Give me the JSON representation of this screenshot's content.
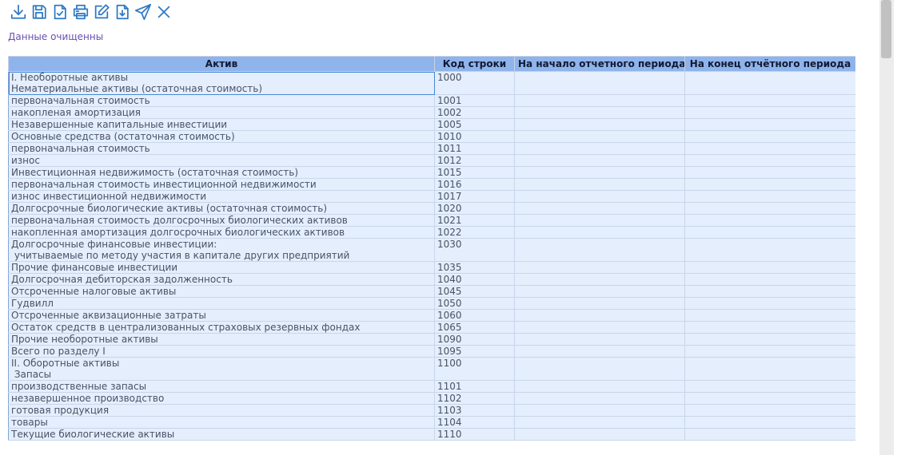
{
  "toolbar": {
    "buttons": [
      {
        "name": "download",
        "icon": "download-icon"
      },
      {
        "name": "save",
        "icon": "floppy-disk-icon"
      },
      {
        "name": "check-document",
        "icon": "document-check-icon"
      },
      {
        "name": "print",
        "icon": "printer-icon"
      },
      {
        "name": "edit",
        "icon": "pencil-square-icon"
      },
      {
        "name": "import",
        "icon": "document-download-icon"
      },
      {
        "name": "send",
        "icon": "paper-plane-icon"
      },
      {
        "name": "close",
        "icon": "close-icon"
      }
    ]
  },
  "status": {
    "text": "Данные  очищенны"
  },
  "table": {
    "headers": [
      "Актив",
      "Код строки",
      "На начало отчетного периода",
      "На конец отчётного периода"
    ],
    "rows": [
      {
        "name": "I. Необоротные активы\nНематериальные активы (остаточная стоимость)",
        "code": "1000",
        "start": "",
        "end": ""
      },
      {
        "name": "первоначальная стоимость",
        "code": "1001",
        "start": "",
        "end": ""
      },
      {
        "name": "накопленая амортизация",
        "code": "1002",
        "start": "",
        "end": ""
      },
      {
        "name": "Незавершенные капитальные инвестиции",
        "code": "1005",
        "start": "",
        "end": ""
      },
      {
        "name": "Основные средства (остаточная стоимость)",
        "code": "1010",
        "start": "",
        "end": ""
      },
      {
        "name": "первоначальная стоимость",
        "code": "1011",
        "start": "",
        "end": ""
      },
      {
        "name": "износ",
        "code": "1012",
        "start": "",
        "end": ""
      },
      {
        "name": "Инвестиционная недвижимость (остаточная стоимость)",
        "code": "1015",
        "start": "",
        "end": ""
      },
      {
        "name": "первоначальная стоимость инвестиционной недвижимости",
        "code": "1016",
        "start": "",
        "end": ""
      },
      {
        "name": "износ инвестиционной недвижимости",
        "code": "1017",
        "start": "",
        "end": ""
      },
      {
        "name": "Долгосрочные биологические активы (остаточная стоимость)",
        "code": "1020",
        "start": "",
        "end": ""
      },
      {
        "name": "первоначальная стоимость долгосрочных биологических активов",
        "code": "1021",
        "start": "",
        "end": ""
      },
      {
        "name": "накопленная амортизация долгосрочных биологических активов",
        "code": "1022",
        "start": "",
        "end": ""
      },
      {
        "name": "Долгосрочные финансовые инвестиции:\n учитываемые по методу участия в капитале других предприятий",
        "code": "1030",
        "start": "",
        "end": ""
      },
      {
        "name": "Прочие финансовые инвестиции",
        "code": "1035",
        "start": "",
        "end": ""
      },
      {
        "name": "Долгосрочная дебиторская задолженность",
        "code": "1040",
        "start": "",
        "end": ""
      },
      {
        "name": "Отсроченные налоговые активы",
        "code": "1045",
        "start": "",
        "end": ""
      },
      {
        "name": "Гудвилл",
        "code": "1050",
        "start": "",
        "end": ""
      },
      {
        "name": "Отсроченные аквизационные затраты",
        "code": "1060",
        "start": "",
        "end": ""
      },
      {
        "name": "Остаток средств в централизованных страховых резервных фондах",
        "code": "1065",
        "start": "",
        "end": ""
      },
      {
        "name": "Прочие необоротные активы",
        "code": "1090",
        "start": "",
        "end": ""
      },
      {
        "name": "Всего по разделу I",
        "code": "1095",
        "start": "",
        "end": ""
      },
      {
        "name": "II. Оборотные активы\n Запасы",
        "code": "1100",
        "start": "",
        "end": ""
      },
      {
        "name": "производственные запасы",
        "code": "1101",
        "start": "",
        "end": ""
      },
      {
        "name": "незавершенное производство",
        "code": "1102",
        "start": "",
        "end": ""
      },
      {
        "name": "готовая продукция",
        "code": "1103",
        "start": "",
        "end": ""
      },
      {
        "name": "товары",
        "code": "1104",
        "start": "",
        "end": ""
      },
      {
        "name": "Текущие биологические активы",
        "code": "1110",
        "start": "",
        "end": ""
      }
    ]
  }
}
